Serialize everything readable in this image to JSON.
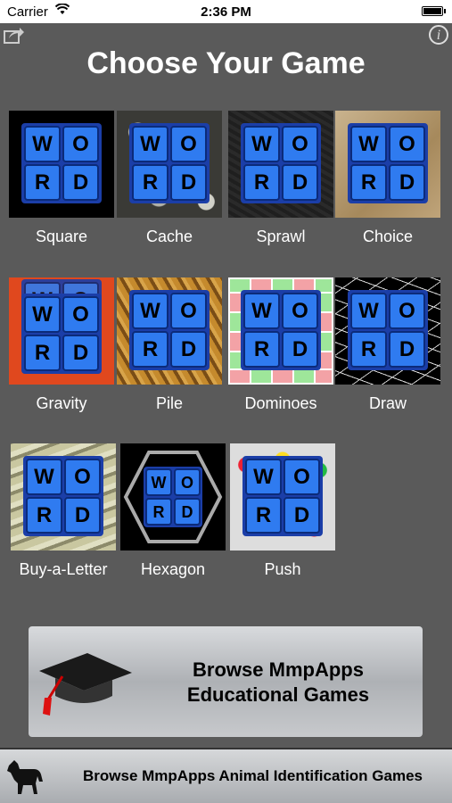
{
  "status": {
    "carrier": "Carrier",
    "time": "2:36 PM"
  },
  "header": {
    "title": "Choose Your Game"
  },
  "board_letters": [
    "W",
    "O",
    "R",
    "D"
  ],
  "games": [
    {
      "label": "Square"
    },
    {
      "label": "Cache"
    },
    {
      "label": "Sprawl"
    },
    {
      "label": "Choice"
    },
    {
      "label": "Gravity"
    },
    {
      "label": "Pile"
    },
    {
      "label": "Dominoes"
    },
    {
      "label": "Draw"
    },
    {
      "label": "Buy-a-Letter"
    },
    {
      "label": "Hexagon"
    },
    {
      "label": "Push"
    }
  ],
  "edu_banner": {
    "line1": "Browse MmpApps",
    "line2": "Educational Games"
  },
  "animal_banner": {
    "text": "Browse MmpApps Animal Identification Games"
  },
  "icons": {
    "share": "share-icon",
    "info": "info-icon",
    "cap": "graduation-cap-icon",
    "horse": "horse-icon"
  }
}
